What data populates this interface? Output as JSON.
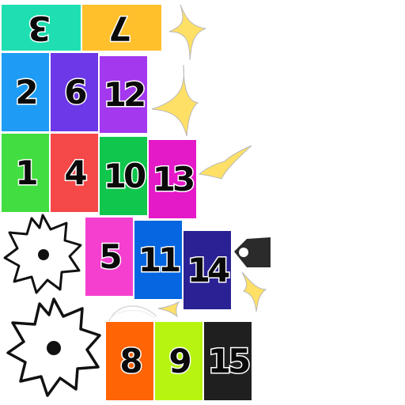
{
  "tiles": [
    {
      "label": "3",
      "color": "#1fdfb2",
      "rotated": true
    },
    {
      "label": "7",
      "color": "#ffc02b",
      "rotated": true
    },
    {
      "label": "2",
      "color": "#1e9cf5"
    },
    {
      "label": "6",
      "color": "#6c38e8"
    },
    {
      "label": "12",
      "color": "#a338ee"
    },
    {
      "label": "1",
      "color": "#42dd40"
    },
    {
      "label": "4",
      "color": "#f54848"
    },
    {
      "label": "10",
      "color": "#10c64d"
    },
    {
      "label": "13",
      "color": "#e419c7"
    },
    {
      "label": "5",
      "color": "#f540cf"
    },
    {
      "label": "11",
      "color": "#0466e0"
    },
    {
      "label": "14",
      "color": "#2a2294"
    },
    {
      "label": "8",
      "color": "#ff6405"
    },
    {
      "label": "9",
      "color": "#b7f511"
    },
    {
      "label": "15",
      "color": "#1f1f1f"
    }
  ],
  "sprites": {
    "saw_icon_name": "saw-blade-icon",
    "spark_icon_name": "spark-icon",
    "blade_icon_name": "knife-blade-icon",
    "swoosh_icon_name": "slash-arc-icon",
    "spark_color": "#ffe066",
    "saw_color": "#ffffff"
  }
}
